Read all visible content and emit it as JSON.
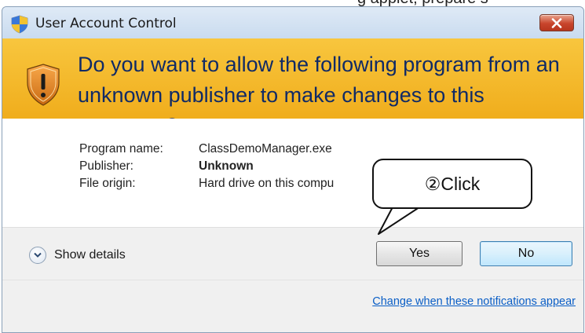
{
  "background_fragment": "g applet, prepare s",
  "window": {
    "title": "User Account Control",
    "close_icon": "close-x-icon"
  },
  "banner": {
    "icon": "warning-shield-icon",
    "line1": "Do you want to allow the following program from an",
    "line2": "unknown publisher to make changes to this computer?"
  },
  "details": {
    "program_name_label": "Program name:",
    "program_name_value": "ClassDemoManager.exe",
    "publisher_label": "Publisher:",
    "publisher_value": "Unknown",
    "file_origin_label": "File origin:",
    "file_origin_value": "Hard drive on this compu"
  },
  "callout": {
    "text": "②Click"
  },
  "footer": {
    "show_details_label": "Show details",
    "yes_label": "Yes",
    "no_label": "No",
    "notifications_link": "Change when these notifications appear"
  },
  "colors": {
    "banner": "#f4b92a",
    "banner_text": "#102a66",
    "link": "#0a5ec6",
    "close_button": "#c8452c"
  }
}
